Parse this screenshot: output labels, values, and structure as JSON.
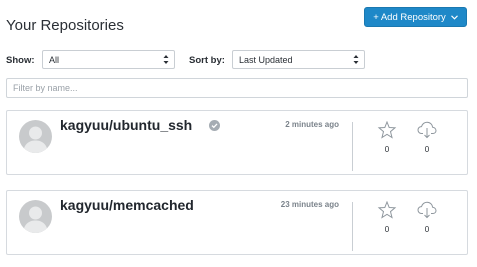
{
  "header": {
    "title": "Your Repositories",
    "add_button_label": "+ Add Repository"
  },
  "filters": {
    "show_label": "Show:",
    "show_value": "All",
    "sort_label": "Sort by:",
    "sort_value": "Last Updated"
  },
  "search": {
    "placeholder": "Filter by name..."
  },
  "repositories": [
    {
      "name": "kagyuu/ubuntu_ssh",
      "verified": true,
      "updated": "2 minutes ago",
      "stars": "0",
      "pulls": "0"
    },
    {
      "name": "kagyuu/memcached",
      "verified": false,
      "updated": "23 minutes ago",
      "stars": "0",
      "pulls": "0"
    }
  ],
  "colors": {
    "accent": "#1e88c8",
    "badge": "#a5acb3"
  }
}
